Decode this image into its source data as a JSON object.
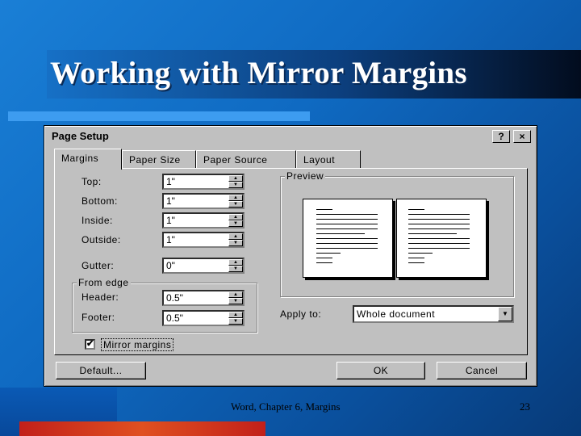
{
  "slide": {
    "title": "Working with Mirror Margins",
    "footer": "Word, Chapter 6, Margins",
    "page_number": "23"
  },
  "dialog": {
    "title": "Page Setup",
    "help_glyph": "?",
    "close_glyph": "×",
    "tabs": [
      {
        "label": "Margins",
        "active": true
      },
      {
        "label": "Paper Size",
        "active": false
      },
      {
        "label": "Paper Source",
        "active": false
      },
      {
        "label": "Layout",
        "active": false
      }
    ],
    "fields": {
      "top": {
        "label": "Top:",
        "value": "1\""
      },
      "bottom": {
        "label": "Bottom:",
        "value": "1\""
      },
      "inside": {
        "label": "Inside:",
        "value": "1\""
      },
      "outside": {
        "label": "Outside:",
        "value": "1\""
      },
      "gutter": {
        "label": "Gutter:",
        "value": "0\""
      },
      "header": {
        "label": "Header:",
        "value": "0.5\""
      },
      "footer": {
        "label": "Footer:",
        "value": "0.5\""
      }
    },
    "from_edge_label": "From edge",
    "preview_label": "Preview",
    "apply_to": {
      "label": "Apply to:",
      "value": "Whole document"
    },
    "mirror_margins": {
      "label": "Mirror margins",
      "checked": true,
      "check_glyph": "✔"
    },
    "buttons": {
      "default": "Default...",
      "ok": "OK",
      "cancel": "Cancel"
    }
  }
}
